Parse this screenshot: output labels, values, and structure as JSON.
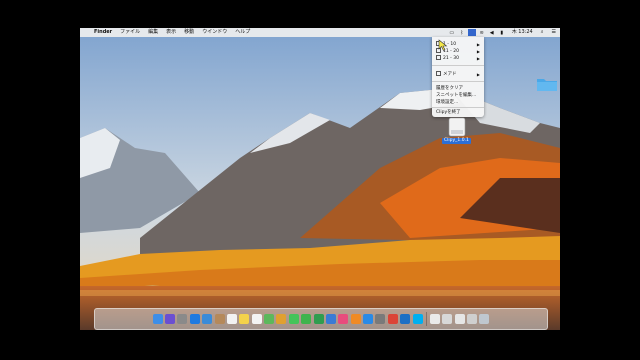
{
  "menubar": {
    "apple_glyph": "",
    "app_name": "Finder",
    "menus": [
      "ファイル",
      "編集",
      "表示",
      "移動",
      "ウインドウ",
      "ヘルプ"
    ],
    "clock": "木 13:24",
    "clip_glyph": "",
    "tray_icons": [
      "clipy-icon",
      "bluetooth-icon",
      "clipy-app-icon",
      "wifi-icon",
      "volume-icon",
      "battery-icon"
    ]
  },
  "clipy_menu": {
    "items": [
      {
        "label": "1 - 10",
        "submenu": true
      },
      {
        "label": "11 - 20",
        "submenu": true
      },
      {
        "label": "21 - 30",
        "submenu": true
      }
    ],
    "snippets": {
      "label": "メアド",
      "submenu": true
    },
    "actions": [
      "履歴をクリア",
      "スニペットを編集...",
      "環境設定...",
      "Clipyを終了"
    ]
  },
  "desktop": {
    "dmg_label": "Clipy_1.0.1",
    "folder_color": "#4aa8e8"
  },
  "dock": {
    "apps": [
      {
        "name": "finder-icon",
        "color": "#3d8ee8"
      },
      {
        "name": "siri-icon",
        "color": "#6b4fd1"
      },
      {
        "name": "launchpad-icon",
        "color": "#8a8a8a"
      },
      {
        "name": "safari-icon",
        "color": "#1f7ae0"
      },
      {
        "name": "mail-icon",
        "color": "#3b8bd8"
      },
      {
        "name": "contacts-icon",
        "color": "#b5895a"
      },
      {
        "name": "calendar-icon",
        "color": "#f2f2f2"
      },
      {
        "name": "notes-icon",
        "color": "#f4d24a"
      },
      {
        "name": "reminders-icon",
        "color": "#f4f4f4"
      },
      {
        "name": "maps-icon",
        "color": "#5cb85c"
      },
      {
        "name": "photos-icon",
        "color": "#e0a030"
      },
      {
        "name": "messages-icon",
        "color": "#45c45a"
      },
      {
        "name": "facetime-icon",
        "color": "#3fb44d"
      },
      {
        "name": "numbers-icon",
        "color": "#2f9d4f"
      },
      {
        "name": "keynote-icon",
        "color": "#3a7bd5"
      },
      {
        "name": "itunes-icon",
        "color": "#e84c7d"
      },
      {
        "name": "ibooks-icon",
        "color": "#f08a24"
      },
      {
        "name": "appstore-icon",
        "color": "#2a8ae6"
      },
      {
        "name": "system-preferences-icon",
        "color": "#7a7a7a"
      },
      {
        "name": "chrome-icon",
        "color": "#db4437"
      },
      {
        "name": "xcode-icon",
        "color": "#1d6fc4"
      },
      {
        "name": "skype-icon",
        "color": "#00aff0"
      }
    ],
    "right": [
      {
        "name": "document-icon",
        "color": "#eaeaea"
      },
      {
        "name": "downloads-icon",
        "color": "#d8d8d8"
      },
      {
        "name": "preview-icon",
        "color": "#e6e6e6"
      },
      {
        "name": "screenshot-icon",
        "color": "#cfcfcf"
      },
      {
        "name": "trash-icon",
        "color": "#bfc7cf"
      }
    ]
  }
}
